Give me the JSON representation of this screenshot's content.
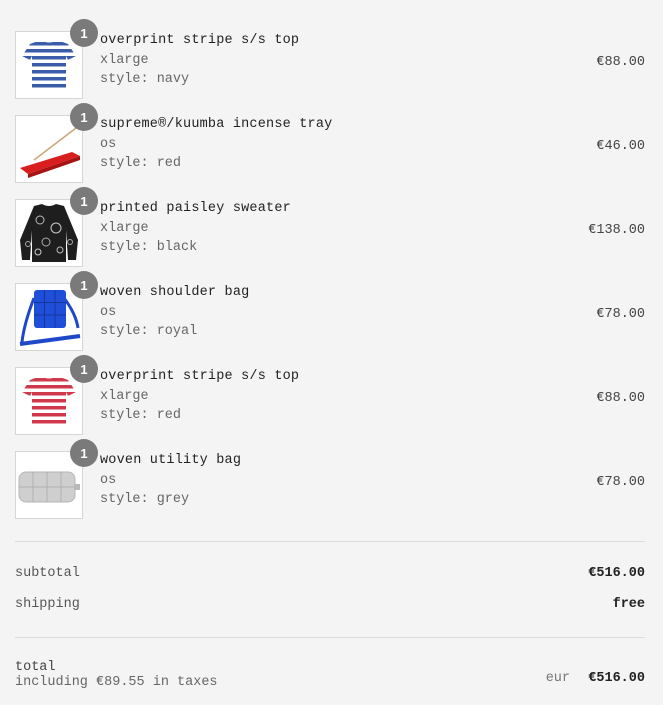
{
  "items": [
    {
      "qty": "1",
      "name": "overprint stripe s/s top",
      "size": "xlarge",
      "style": "style: navy",
      "price": "€88.00",
      "icon": "navy-striped-tshirt-image"
    },
    {
      "qty": "1",
      "name": "supreme®/kuumba incense tray",
      "size": "os",
      "style": "style: red",
      "price": "€46.00",
      "icon": "red-incense-tray-image"
    },
    {
      "qty": "1",
      "name": "printed paisley sweater",
      "size": "xlarge",
      "style": "style: black",
      "price": "€138.00",
      "icon": "black-paisley-sweater-image"
    },
    {
      "qty": "1",
      "name": "woven shoulder bag",
      "size": "os",
      "style": "style: royal",
      "price": "€78.00",
      "icon": "royal-blue-shoulder-bag-image"
    },
    {
      "qty": "1",
      "name": "overprint stripe s/s top",
      "size": "xlarge",
      "style": "style: red",
      "price": "€88.00",
      "icon": "red-striped-tshirt-image"
    },
    {
      "qty": "1",
      "name": "woven utility bag",
      "size": "os",
      "style": "style: grey",
      "price": "€78.00",
      "icon": "grey-utility-bag-image"
    }
  ],
  "summary": {
    "subtotal_label": "subtotal",
    "subtotal_value": "€516.00",
    "shipping_label": "shipping",
    "shipping_value": "free"
  },
  "total": {
    "label": "total",
    "taxes": "including €89.55 in taxes",
    "currency": "eur",
    "value": "€516.00"
  },
  "colors": {
    "background": "#f4f4f4",
    "badge": "#7a7a7a",
    "divider": "#dcdcdc"
  }
}
